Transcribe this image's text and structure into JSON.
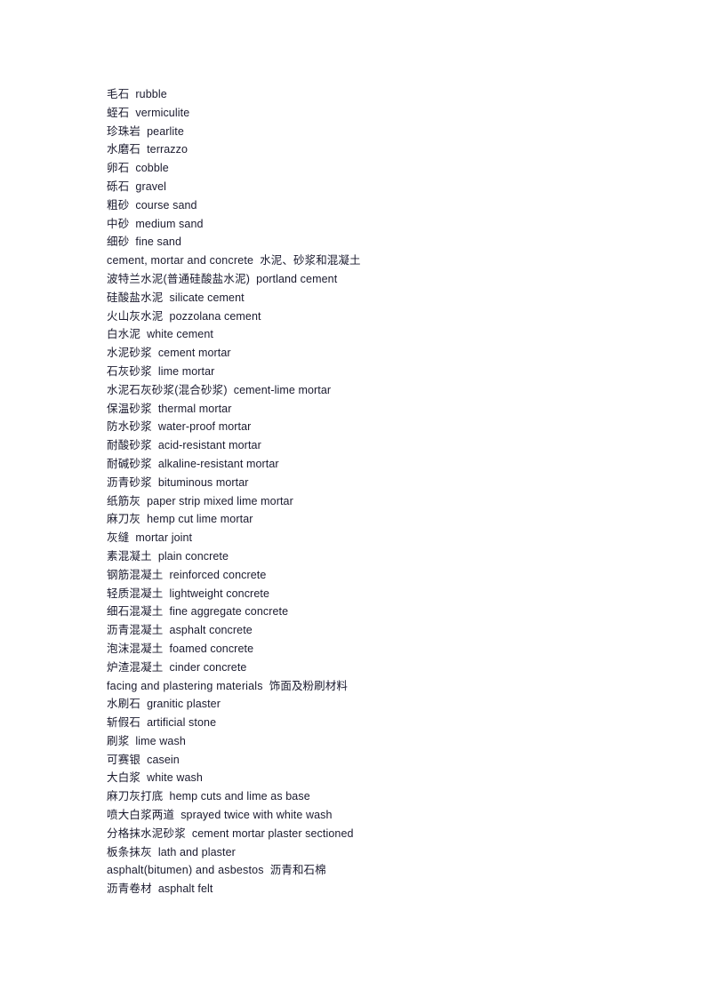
{
  "document": {
    "lines": [
      {
        "first": "毛石",
        "second": "rubble"
      },
      {
        "first": "蛭石",
        "second": "vermiculite"
      },
      {
        "first": "珍珠岩",
        "second": "pearlite"
      },
      {
        "first": "水磨石",
        "second": "terrazzo"
      },
      {
        "first": "卵石",
        "second": "cobble"
      },
      {
        "first": "砾石",
        "second": "gravel"
      },
      {
        "first": "粗砂",
        "second": "course sand"
      },
      {
        "first": "中砂",
        "second": "medium sand"
      },
      {
        "first": "细砂",
        "second": "fine sand"
      },
      {
        "first": "cement, mortar and concrete",
        "second": "水泥、砂浆和混凝土"
      },
      {
        "first": "波特兰水泥(普通硅酸盐水泥)",
        "second": "portland cement"
      },
      {
        "first": "硅酸盐水泥",
        "second": "silicate cement"
      },
      {
        "first": "火山灰水泥",
        "second": "pozzolana cement"
      },
      {
        "first": "白水泥",
        "second": "white cement"
      },
      {
        "first": "水泥砂浆",
        "second": "cement mortar"
      },
      {
        "first": "石灰砂浆",
        "second": "lime mortar"
      },
      {
        "first": "水泥石灰砂浆(混合砂浆)",
        "second": "cement-lime mortar"
      },
      {
        "first": "保温砂浆",
        "second": "thermal mortar"
      },
      {
        "first": "防水砂浆",
        "second": "water-proof mortar"
      },
      {
        "first": "耐酸砂浆",
        "second": "acid-resistant mortar"
      },
      {
        "first": "耐碱砂浆",
        "second": "alkaline-resistant  mortar"
      },
      {
        "first": "沥青砂浆",
        "second": "bituminous mortar"
      },
      {
        "first": "纸筋灰",
        "second": "paper strip mixed lime mortar"
      },
      {
        "first": "麻刀灰",
        "second": "hemp cut lime mortar"
      },
      {
        "first": "灰缝",
        "second": "mortar joint"
      },
      {
        "first": "素混凝土",
        "second": "plain concrete"
      },
      {
        "first": "钢筋混凝土",
        "second": "reinforced concrete"
      },
      {
        "first": "轻质混凝土",
        "second": "lightweight concrete"
      },
      {
        "first": "细石混凝土",
        "second": "fine aggregate concrete"
      },
      {
        "first": "沥青混凝土",
        "second": "asphalt concrete"
      },
      {
        "first": "泡沫混凝土",
        "second": "foamed concrete"
      },
      {
        "first": "炉渣混凝土",
        "second": "cinder concrete"
      },
      {
        "first": "facing and plastering materials",
        "second": "饰面及粉刷材料"
      },
      {
        "first": "水刷石",
        "second": "granitic plaster"
      },
      {
        "first": "斩假石",
        "second": "artificial stone"
      },
      {
        "first": "刷浆",
        "second": "lime wash"
      },
      {
        "first": "可赛银",
        "second": "casein"
      },
      {
        "first": "大白浆",
        "second": "white wash"
      },
      {
        "first": "麻刀灰打底",
        "second": "hemp cuts and lime as base"
      },
      {
        "first": "喷大白浆两道",
        "second": "sprayed twice with white wash"
      },
      {
        "first": "分格抹水泥砂浆",
        "second": "cement mortar plaster sectioned"
      },
      {
        "first": "板条抹灰",
        "second": "lath and plaster"
      },
      {
        "first": "asphalt(bitumen) and asbestos",
        "second": "沥青和石棉"
      },
      {
        "first": "沥青卷材",
        "second": "asphalt felt"
      }
    ]
  }
}
